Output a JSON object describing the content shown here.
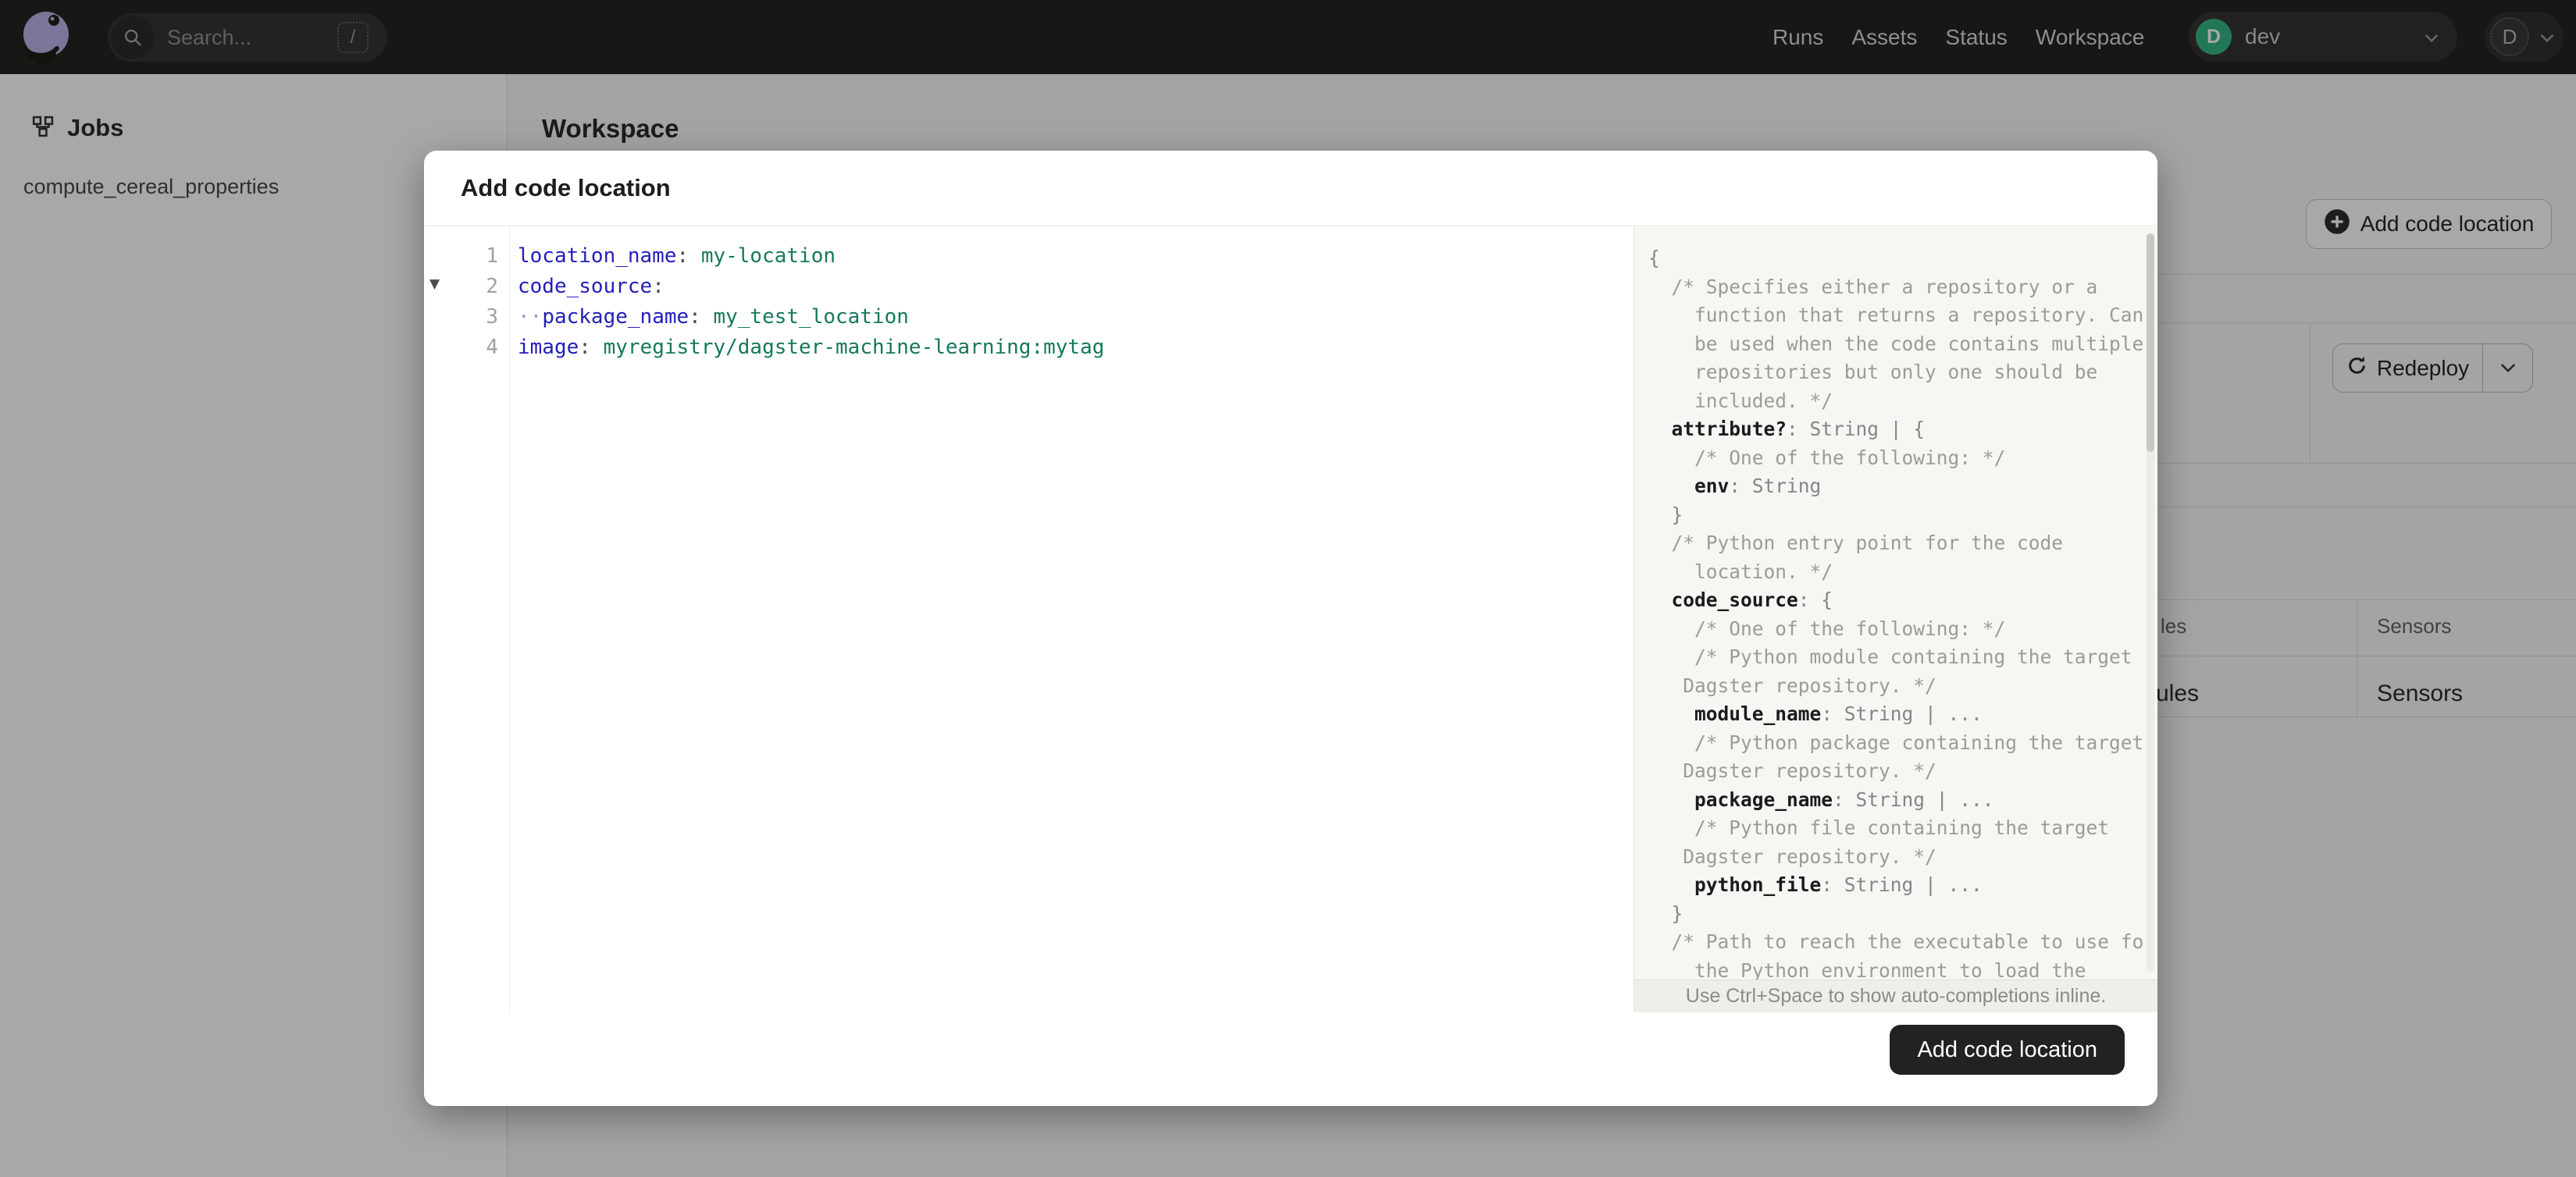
{
  "topbar": {
    "search_placeholder": "Search...",
    "search_shortcut": "/",
    "nav": [
      {
        "label": "Runs"
      },
      {
        "label": "Assets"
      },
      {
        "label": "Status"
      },
      {
        "label": "Workspace"
      }
    ],
    "deployment": {
      "initial": "D",
      "label": "dev"
    },
    "user_initial": "D"
  },
  "sidebar": {
    "section": "Jobs",
    "items": [
      {
        "label": "compute_cereal_properties"
      }
    ]
  },
  "page": {
    "title": "Workspace",
    "add_button": "Add code location",
    "redeploy_button": "Redeploy",
    "table": {
      "header_fragments": [
        "les",
        "Sensors"
      ],
      "row_fragments": [
        "ules",
        "Sensors"
      ]
    }
  },
  "modal": {
    "title": "Add code location",
    "submit_button": "Add code location",
    "hint": "Use Ctrl+Space to show auto-completions inline.",
    "editor_lines": [
      {
        "n": "1",
        "segs": [
          [
            "k",
            "location_name"
          ],
          [
            "p",
            ": "
          ],
          [
            "v",
            "my-location"
          ]
        ]
      },
      {
        "n": "2",
        "fold": true,
        "segs": [
          [
            "k",
            "code_source"
          ],
          [
            "p",
            ":"
          ]
        ]
      },
      {
        "n": "3",
        "segs": [
          [
            "w",
            "··"
          ],
          [
            "k",
            "package_name"
          ],
          [
            "p",
            ": "
          ],
          [
            "v",
            "my_test_location"
          ]
        ]
      },
      {
        "n": "4",
        "segs": [
          [
            "k",
            "image"
          ],
          [
            "p",
            ": "
          ],
          [
            "v",
            "myregistry/dagster-machine-learning:mytag"
          ]
        ]
      }
    ],
    "schema_lines": [
      [
        [
          "p",
          "{"
        ]
      ],
      [
        [
          "c",
          "  /* Specifies either a repository or a"
        ]
      ],
      [
        [
          "c",
          "    function that returns a repository. Can"
        ]
      ],
      [
        [
          "c",
          "    be used when the code contains multiple"
        ]
      ],
      [
        [
          "c",
          "    repositories but only one should be"
        ]
      ],
      [
        [
          "c",
          "    included. */"
        ]
      ],
      [
        [
          "p",
          "  "
        ],
        [
          "k",
          "attribute?"
        ],
        [
          "p",
          ": String | {"
        ]
      ],
      [
        [
          "c",
          "    /* One of the following: */"
        ]
      ],
      [
        [
          "p",
          "    "
        ],
        [
          "k",
          "env"
        ],
        [
          "p",
          ": String"
        ]
      ],
      [
        [
          "p",
          "  }"
        ]
      ],
      [
        [
          "c",
          "  /* Python entry point for the code"
        ]
      ],
      [
        [
          "c",
          "    location. */"
        ]
      ],
      [
        [
          "p",
          "  "
        ],
        [
          "k",
          "code_source"
        ],
        [
          "p",
          ": {"
        ]
      ],
      [
        [
          "c",
          "    /* One of the following: */"
        ]
      ],
      [
        [
          "c",
          "    /* Python module containing the target"
        ]
      ],
      [
        [
          "c",
          "   Dagster repository. */"
        ]
      ],
      [
        [
          "p",
          "    "
        ],
        [
          "k",
          "module_name"
        ],
        [
          "p",
          ": String | ..."
        ]
      ],
      [
        [
          "c",
          "    /* Python package containing the target"
        ]
      ],
      [
        [
          "c",
          "   Dagster repository. */"
        ]
      ],
      [
        [
          "p",
          "    "
        ],
        [
          "k",
          "package_name"
        ],
        [
          "p",
          ": String | ..."
        ]
      ],
      [
        [
          "c",
          "    /* Python file containing the target"
        ]
      ],
      [
        [
          "c",
          "   Dagster repository. */"
        ]
      ],
      [
        [
          "p",
          "    "
        ],
        [
          "k",
          "python_file"
        ],
        [
          "p",
          ": String | ..."
        ]
      ],
      [
        [
          "p",
          "  }"
        ]
      ],
      [
        [
          "c",
          "  /* Path to reach the executable to use for"
        ]
      ],
      [
        [
          "c",
          "    the Python environment to load the"
        ]
      ]
    ]
  },
  "colors": {
    "yaml_key": "#231EB9",
    "yaml_value": "#15795B",
    "deployment_green": "#2EB380",
    "primary_button_bg": "#242122"
  }
}
